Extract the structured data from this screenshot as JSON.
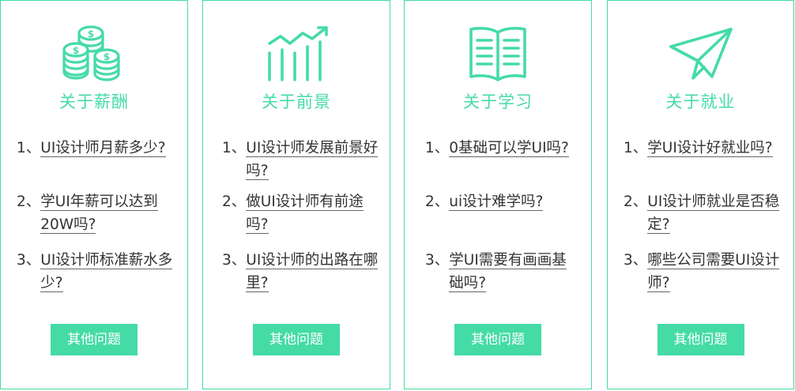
{
  "cards": [
    {
      "icon": "coins-icon",
      "title": "关于薪酬",
      "questions": [
        {
          "num": "1、",
          "text": "UI设计师月薪多少?"
        },
        {
          "num": "2、",
          "text": "学UI年薪可以达到20W吗?"
        },
        {
          "num": "3、",
          "text": "UI设计师标准薪水多少?"
        }
      ],
      "button": "其他问题"
    },
    {
      "icon": "growth-chart-icon",
      "title": "关于前景",
      "questions": [
        {
          "num": "1、",
          "text": "UI设计师发展前景好吗?"
        },
        {
          "num": "2、",
          "text": "做UI设计师有前途吗?"
        },
        {
          "num": "3、",
          "text": "UI设计师的出路在哪里?"
        }
      ],
      "button": "其他问题"
    },
    {
      "icon": "open-book-icon",
      "title": "关于学习",
      "questions": [
        {
          "num": "1、",
          "text": "0基础可以学UI吗?"
        },
        {
          "num": "2、",
          "text": "ui设计难学吗?"
        },
        {
          "num": "3、",
          "text": "学UI需要有画画基础吗?"
        }
      ],
      "button": "其他问题"
    },
    {
      "icon": "paper-plane-icon",
      "title": "关于就业",
      "questions": [
        {
          "num": "1、",
          "text": "学UI设计好就业吗?"
        },
        {
          "num": "2、",
          "text": "UI设计师就业是否稳定?"
        },
        {
          "num": "3、",
          "text": "哪些公司需要UI设计师?"
        }
      ],
      "button": "其他问题"
    }
  ],
  "accent_color": "#45dba6"
}
